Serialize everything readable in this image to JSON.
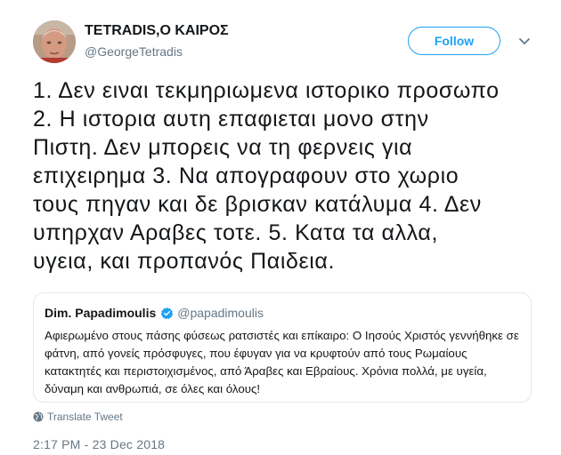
{
  "tweet": {
    "author_name": "TETRADIS,Ο ΚΑΙΡΟΣ",
    "author_handle": "@GeorgeTetradis",
    "follow_label": "Follow",
    "text_lines": [
      "1. Δεν ειναι τεκμηριωμενα ιστορικο προσωπο",
      "2. Η ιστορια  αυτη επαφιεται μονο στην",
      "Πιστη. Δεν μπορεις να τη φερνεις για",
      "επιχειρημα 3. Να απογραφουν στο χωριο",
      "τους πηγαν και δε βρισκαν κατάλυμα 4. Δεν",
      "υπηρχαν Αραβες τοτε. 5. Κατα τα αλλα,",
      "υγεια, και προπανός Παιδεια."
    ],
    "translate_label": "Translate Tweet",
    "timestamp": "2:17 PM - 23 Dec 2018"
  },
  "quote": {
    "author_name": "Dim. Papadimoulis",
    "author_handle": "@papadimoulis",
    "text": "Αφιερωμένο στους πάσης φύσεως  ρατσιστές και επίκαιρο: Ο Ιησούς Χριστός γεννήθηκε σε φάτνη, από γονείς πρόσφυγες, που έφυγαν για να κρυφτούν από τους Ρωμαίους κατακτητές και περιστοιχισμένος, από Άραβες και Εβραίους. Χρόνια πολλά, με υγεία, δύναμη και ανθρωπιά, σε όλες και όλους!"
  },
  "icons": {
    "caret": "chevron-down-icon",
    "verified": "verified-badge-icon",
    "translate": "globe-icon"
  },
  "colors": {
    "accent": "#1da1f2",
    "secondary_text": "#657786",
    "border": "#e1e8ed"
  }
}
